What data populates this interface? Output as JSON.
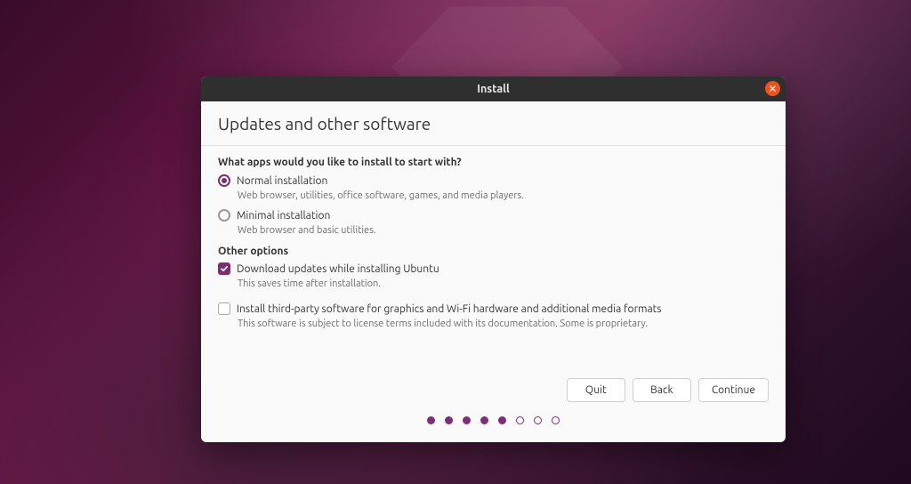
{
  "window": {
    "title": "Install"
  },
  "page": {
    "heading": "Updates and other software",
    "question": "What apps would you like to install to start with?"
  },
  "install_type": {
    "normal": {
      "label": "Normal installation",
      "desc": "Web browser, utilities, office software, games, and media players.",
      "selected": true
    },
    "minimal": {
      "label": "Minimal installation",
      "desc": "Web browser and basic utilities.",
      "selected": false
    }
  },
  "other_options": {
    "heading": "Other options",
    "download_updates": {
      "label": "Download updates while installing Ubuntu",
      "desc": "This saves time after installation.",
      "checked": true
    },
    "third_party": {
      "label": "Install third-party software for graphics and Wi-Fi hardware and additional media formats",
      "desc": "This software is subject to license terms included with its documentation. Some is proprietary.",
      "checked": false
    }
  },
  "buttons": {
    "quit": "Quit",
    "back": "Back",
    "continue": "Continue"
  },
  "progress": {
    "total": 8,
    "current": 5
  }
}
